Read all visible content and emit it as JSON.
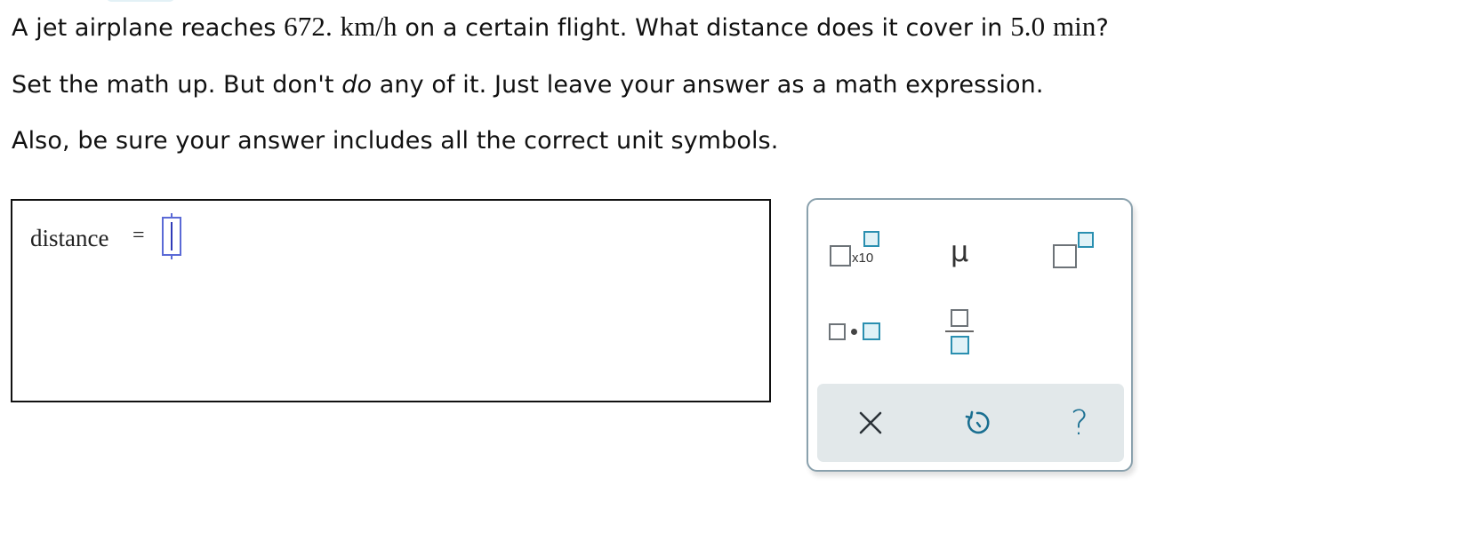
{
  "question": {
    "line1_pre": "A jet airplane reaches ",
    "speed_value": "672.",
    "speed_unit": "km/h",
    "line1_mid": " on a certain flight. What distance does it cover in ",
    "time_value": "5.0",
    "time_unit": "min",
    "line1_post": "?",
    "line2_pre": "Set the math up. But don't ",
    "line2_emph": "do",
    "line2_post": " any of it. Just leave your answer as a math expression.",
    "line3": "Also, be sure your answer includes all the correct unit symbols."
  },
  "answer": {
    "label": "distance",
    "equals": "=",
    "input_value": ""
  },
  "keypad": {
    "sci_notation_text": "x10",
    "mu_symbol": "μ",
    "icons": {
      "scientific_notation": "scientific-notation-icon",
      "micro": "mu-icon",
      "superscript": "superscript-icon",
      "multiply_dot": "multiply-dot-icon",
      "fraction": "fraction-icon",
      "clear": "close-icon",
      "undo": "undo-icon",
      "help": "help-icon"
    },
    "help_symbol": "?"
  },
  "colors": {
    "teal": "#2a8fb0",
    "input_border": "#5b6ad6",
    "action_bar": "#e2e8ea",
    "keypad_border": "#8aa1ad"
  }
}
